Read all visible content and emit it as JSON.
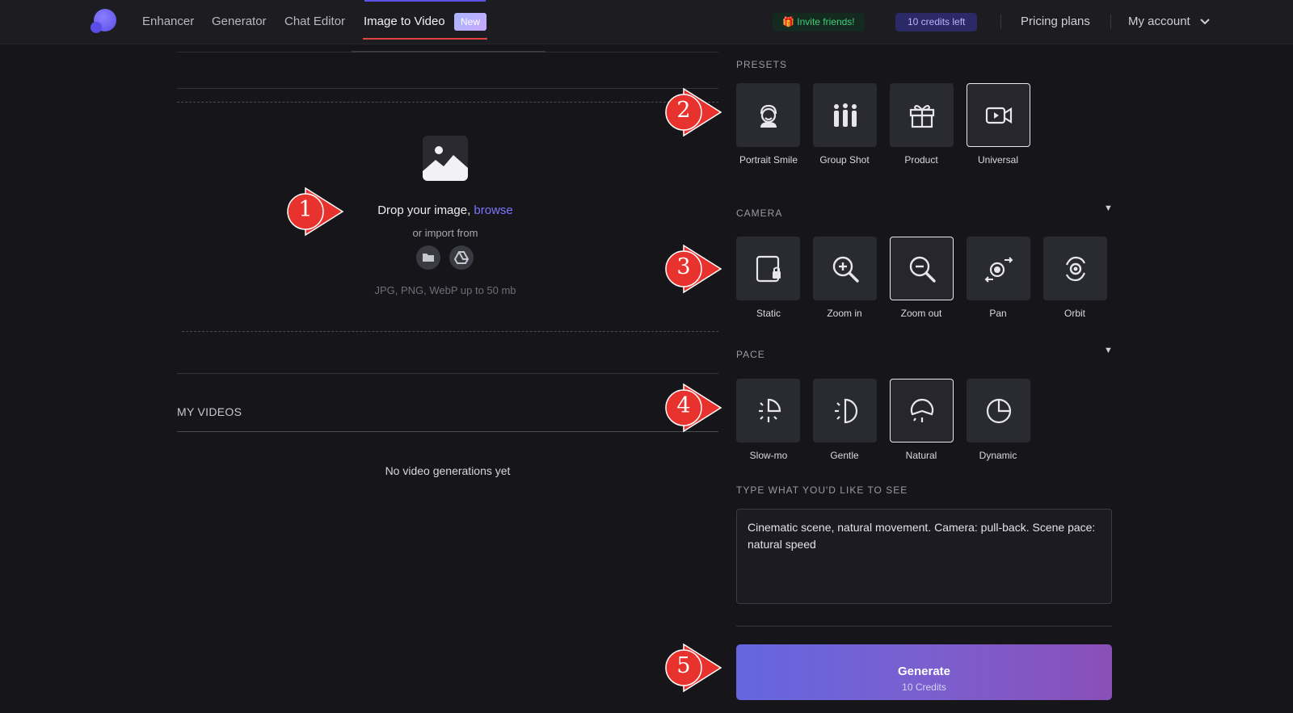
{
  "nav": {
    "items": [
      "Enhancer",
      "Generator",
      "Chat Editor",
      "Image to Video"
    ],
    "new_badge": "New",
    "invite": "🎁 Invite friends!",
    "credits": "10 credits left",
    "pricing": "Pricing plans",
    "account": "My account"
  },
  "upload": {
    "drop_prefix": "Drop your image, ",
    "browse": "browse",
    "import_from": "or import from",
    "formats": "JPG, PNG, WebP up to 50 mb"
  },
  "my_videos": {
    "heading": "MY VIDEOS",
    "empty": "No video generations yet"
  },
  "presets": {
    "label": "PRESETS",
    "items": [
      {
        "label": "Portrait Smile",
        "icon": "portrait-icon",
        "selected": false
      },
      {
        "label": "Group Shot",
        "icon": "group-icon",
        "selected": false
      },
      {
        "label": "Product",
        "icon": "gift-icon",
        "selected": false
      },
      {
        "label": "Universal",
        "icon": "video-camera-icon",
        "selected": true
      }
    ]
  },
  "camera": {
    "label": "CAMERA",
    "toggle": "▼",
    "items": [
      {
        "label": "Static",
        "icon": "static-lock-icon",
        "selected": false
      },
      {
        "label": "Zoom in",
        "icon": "zoom-in-icon",
        "selected": false
      },
      {
        "label": "Zoom out",
        "icon": "zoom-out-icon",
        "selected": true
      },
      {
        "label": "Pan",
        "icon": "pan-icon",
        "selected": false
      },
      {
        "label": "Orbit",
        "icon": "orbit-icon",
        "selected": false
      }
    ]
  },
  "pace": {
    "label": "PACE",
    "toggle": "▼",
    "items": [
      {
        "label": "Slow-mo",
        "icon": "slow-mo-icon",
        "selected": false
      },
      {
        "label": "Gentle",
        "icon": "gentle-icon",
        "selected": false
      },
      {
        "label": "Natural",
        "icon": "natural-icon",
        "selected": true
      },
      {
        "label": "Dynamic",
        "icon": "dynamic-icon",
        "selected": false
      }
    ]
  },
  "prompt": {
    "label": "TYPE WHAT YOU'D LIKE TO SEE",
    "value": "Cinematic scene, natural movement. Camera: pull-back. Scene pace: natural speed"
  },
  "generate": {
    "label": "Generate",
    "cost": "10 Credits"
  },
  "annotations": [
    "1",
    "2",
    "3",
    "4",
    "5"
  ],
  "colors": {
    "background": "#16161a",
    "accent": "#6c63ff",
    "annotation": "#e8322e"
  }
}
